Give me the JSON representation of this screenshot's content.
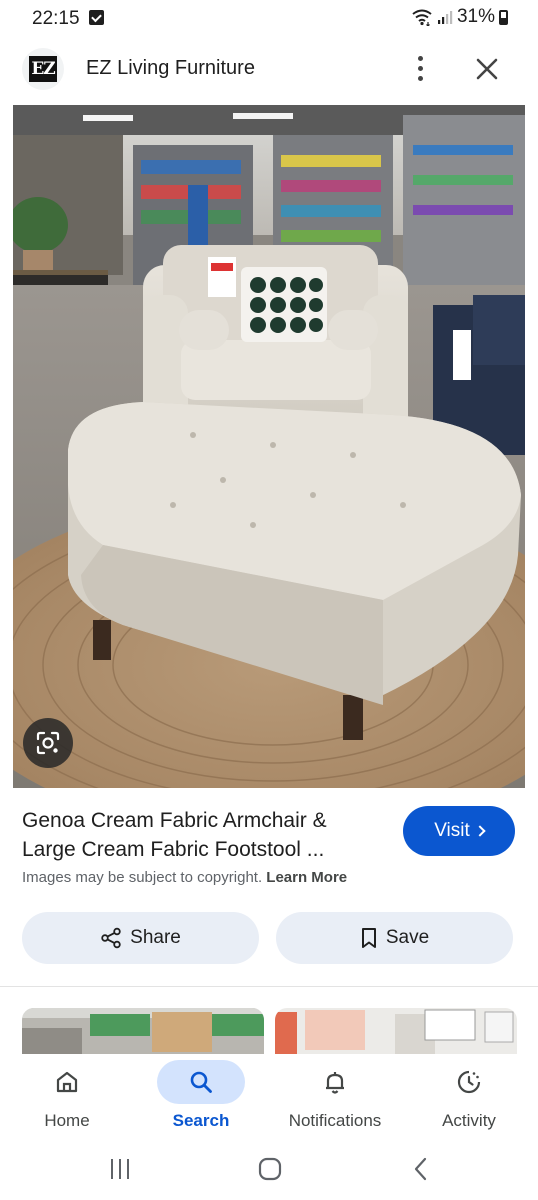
{
  "status_bar": {
    "time": "22:15",
    "battery": "31%",
    "icons": [
      "notification-icon",
      "wifi-icon",
      "signal-icon",
      "battery-icon"
    ]
  },
  "header": {
    "site_name": "EZ Living Furniture",
    "logo_text": "EZ",
    "menu_icon": "more-vert-icon",
    "close_icon": "close-icon"
  },
  "image": {
    "lens_icon": "lens-icon"
  },
  "result": {
    "title": "Genoa Cream Fabric Armchair & Large Cream Fabric Footstool ...",
    "visit_label": "Visit",
    "copyright_text": "Images may be subject to copyright.",
    "learn_more": "Learn More"
  },
  "actions": {
    "share_label": "Share",
    "save_label": "Save"
  },
  "bottom_nav": {
    "items": [
      {
        "label": "Home",
        "icon": "home-icon",
        "active": false
      },
      {
        "label": "Search",
        "icon": "search-icon",
        "active": true
      },
      {
        "label": "Notifications",
        "icon": "bell-icon",
        "active": false
      },
      {
        "label": "Activity",
        "icon": "activity-icon",
        "active": false
      }
    ]
  },
  "colors": {
    "accent": "#0b57d0",
    "pill_bg": "#e9eef6",
    "active_nav_bg": "#d3e3fd"
  }
}
